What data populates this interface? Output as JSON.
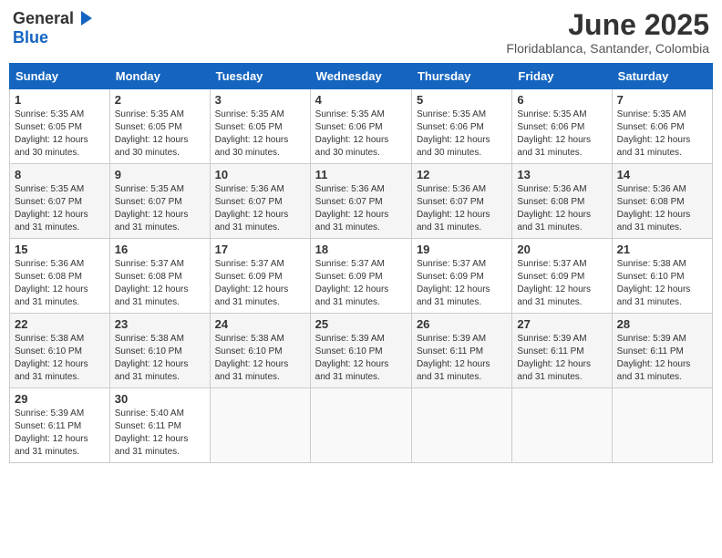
{
  "header": {
    "logo_general": "General",
    "logo_blue": "Blue",
    "month_title": "June 2025",
    "location": "Floridablanca, Santander, Colombia"
  },
  "weekdays": [
    "Sunday",
    "Monday",
    "Tuesday",
    "Wednesday",
    "Thursday",
    "Friday",
    "Saturday"
  ],
  "weeks": [
    [
      {
        "day": "1",
        "sunrise": "5:35 AM",
        "sunset": "6:05 PM",
        "daylight": "12 hours and 30 minutes."
      },
      {
        "day": "2",
        "sunrise": "5:35 AM",
        "sunset": "6:05 PM",
        "daylight": "12 hours and 30 minutes."
      },
      {
        "day": "3",
        "sunrise": "5:35 AM",
        "sunset": "6:05 PM",
        "daylight": "12 hours and 30 minutes."
      },
      {
        "day": "4",
        "sunrise": "5:35 AM",
        "sunset": "6:06 PM",
        "daylight": "12 hours and 30 minutes."
      },
      {
        "day": "5",
        "sunrise": "5:35 AM",
        "sunset": "6:06 PM",
        "daylight": "12 hours and 30 minutes."
      },
      {
        "day": "6",
        "sunrise": "5:35 AM",
        "sunset": "6:06 PM",
        "daylight": "12 hours and 31 minutes."
      },
      {
        "day": "7",
        "sunrise": "5:35 AM",
        "sunset": "6:06 PM",
        "daylight": "12 hours and 31 minutes."
      }
    ],
    [
      {
        "day": "8",
        "sunrise": "5:35 AM",
        "sunset": "6:07 PM",
        "daylight": "12 hours and 31 minutes."
      },
      {
        "day": "9",
        "sunrise": "5:35 AM",
        "sunset": "6:07 PM",
        "daylight": "12 hours and 31 minutes."
      },
      {
        "day": "10",
        "sunrise": "5:36 AM",
        "sunset": "6:07 PM",
        "daylight": "12 hours and 31 minutes."
      },
      {
        "day": "11",
        "sunrise": "5:36 AM",
        "sunset": "6:07 PM",
        "daylight": "12 hours and 31 minutes."
      },
      {
        "day": "12",
        "sunrise": "5:36 AM",
        "sunset": "6:07 PM",
        "daylight": "12 hours and 31 minutes."
      },
      {
        "day": "13",
        "sunrise": "5:36 AM",
        "sunset": "6:08 PM",
        "daylight": "12 hours and 31 minutes."
      },
      {
        "day": "14",
        "sunrise": "5:36 AM",
        "sunset": "6:08 PM",
        "daylight": "12 hours and 31 minutes."
      }
    ],
    [
      {
        "day": "15",
        "sunrise": "5:36 AM",
        "sunset": "6:08 PM",
        "daylight": "12 hours and 31 minutes."
      },
      {
        "day": "16",
        "sunrise": "5:37 AM",
        "sunset": "6:08 PM",
        "daylight": "12 hours and 31 minutes."
      },
      {
        "day": "17",
        "sunrise": "5:37 AM",
        "sunset": "6:09 PM",
        "daylight": "12 hours and 31 minutes."
      },
      {
        "day": "18",
        "sunrise": "5:37 AM",
        "sunset": "6:09 PM",
        "daylight": "12 hours and 31 minutes."
      },
      {
        "day": "19",
        "sunrise": "5:37 AM",
        "sunset": "6:09 PM",
        "daylight": "12 hours and 31 minutes."
      },
      {
        "day": "20",
        "sunrise": "5:37 AM",
        "sunset": "6:09 PM",
        "daylight": "12 hours and 31 minutes."
      },
      {
        "day": "21",
        "sunrise": "5:38 AM",
        "sunset": "6:10 PM",
        "daylight": "12 hours and 31 minutes."
      }
    ],
    [
      {
        "day": "22",
        "sunrise": "5:38 AM",
        "sunset": "6:10 PM",
        "daylight": "12 hours and 31 minutes."
      },
      {
        "day": "23",
        "sunrise": "5:38 AM",
        "sunset": "6:10 PM",
        "daylight": "12 hours and 31 minutes."
      },
      {
        "day": "24",
        "sunrise": "5:38 AM",
        "sunset": "6:10 PM",
        "daylight": "12 hours and 31 minutes."
      },
      {
        "day": "25",
        "sunrise": "5:39 AM",
        "sunset": "6:10 PM",
        "daylight": "12 hours and 31 minutes."
      },
      {
        "day": "26",
        "sunrise": "5:39 AM",
        "sunset": "6:11 PM",
        "daylight": "12 hours and 31 minutes."
      },
      {
        "day": "27",
        "sunrise": "5:39 AM",
        "sunset": "6:11 PM",
        "daylight": "12 hours and 31 minutes."
      },
      {
        "day": "28",
        "sunrise": "5:39 AM",
        "sunset": "6:11 PM",
        "daylight": "12 hours and 31 minutes."
      }
    ],
    [
      {
        "day": "29",
        "sunrise": "5:39 AM",
        "sunset": "6:11 PM",
        "daylight": "12 hours and 31 minutes."
      },
      {
        "day": "30",
        "sunrise": "5:40 AM",
        "sunset": "6:11 PM",
        "daylight": "12 hours and 31 minutes."
      },
      null,
      null,
      null,
      null,
      null
    ]
  ],
  "labels": {
    "sunrise": "Sunrise:",
    "sunset": "Sunset:",
    "daylight": "Daylight:"
  }
}
